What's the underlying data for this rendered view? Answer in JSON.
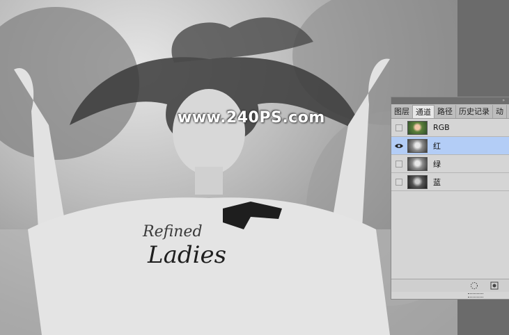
{
  "watermark": "www.240PS.com",
  "channels_panel": {
    "tabs": [
      "图层",
      "通道",
      "路径",
      "历史记录",
      "动"
    ],
    "active_tab_index": 1,
    "channels": [
      {
        "label": "RGB",
        "visible": false,
        "selected": false
      },
      {
        "label": "红",
        "visible": true,
        "selected": true
      },
      {
        "label": "绿",
        "visible": false,
        "selected": false
      },
      {
        "label": "蓝",
        "visible": false,
        "selected": false
      }
    ],
    "footer_icons": [
      "load-selection-icon",
      "save-selection-icon"
    ]
  }
}
